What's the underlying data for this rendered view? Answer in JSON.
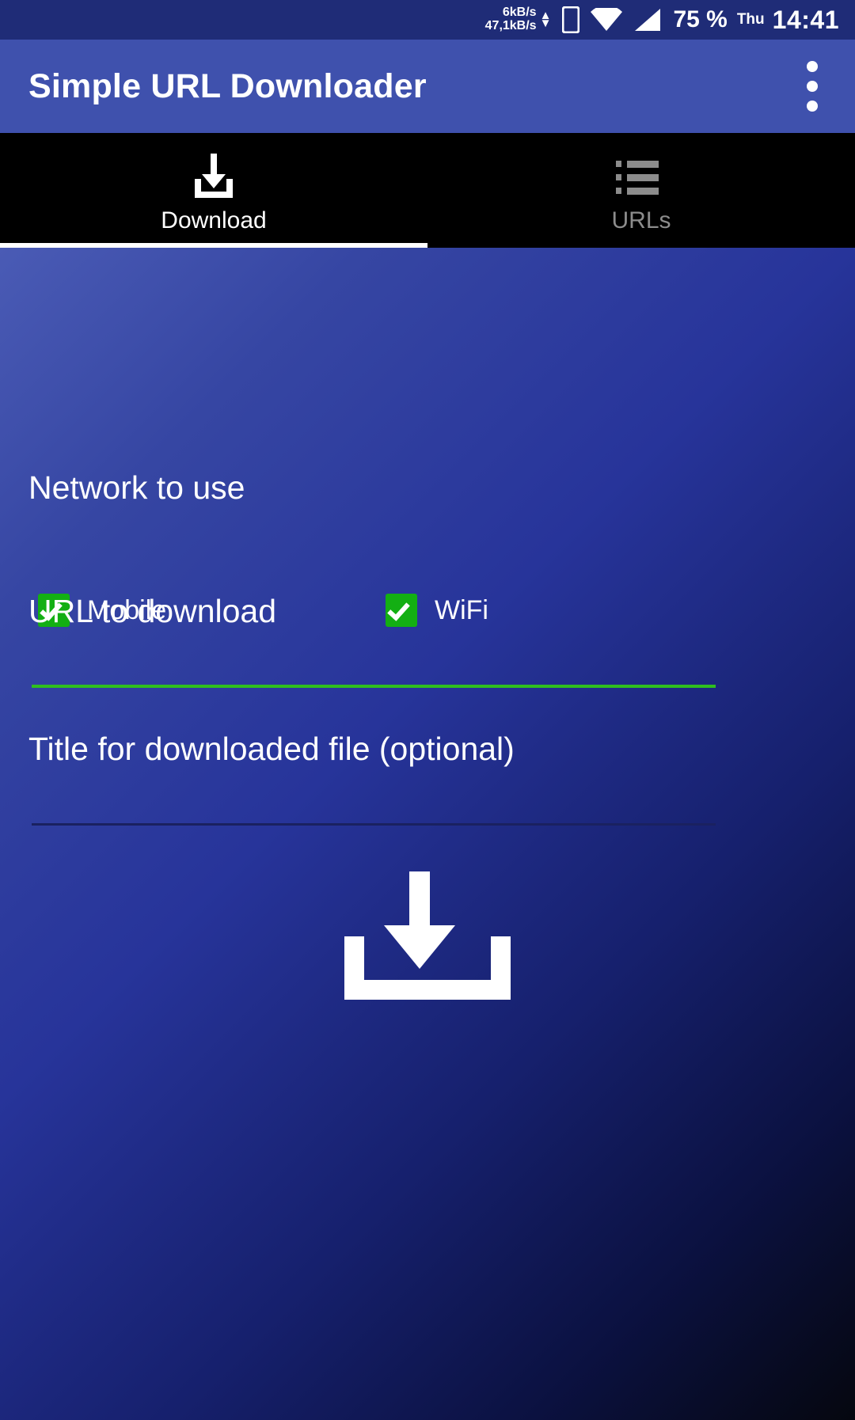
{
  "status_bar": {
    "net_speed_up": "6kB/s",
    "net_speed_down": "47,1kB/s",
    "up_arrow": "▲",
    "down_arrow": "▼",
    "sim_icon": "sim-card-icon",
    "wifi_icon": "wifi-icon",
    "signal_icon": "cellular-signal-icon",
    "battery": "75 %",
    "day": "Thu",
    "time": "14:41"
  },
  "app_bar": {
    "title": "Simple URL Downloader",
    "overflow_icon": "overflow-menu-icon"
  },
  "tabs": [
    {
      "label": "Download",
      "icon": "download-icon",
      "active": true
    },
    {
      "label": "URLs",
      "icon": "list-icon",
      "active": false
    }
  ],
  "main": {
    "network_heading": "Network to use",
    "checkboxes": [
      {
        "label": "Mobile",
        "checked": true
      },
      {
        "label": "WiFi",
        "checked": true
      }
    ],
    "url_field": {
      "label": "URL to download",
      "value": "",
      "placeholder": "",
      "focused": true
    },
    "title_field": {
      "label": "Title for downloaded file (optional)",
      "value": "",
      "placeholder": "",
      "focused": false
    },
    "download_button_icon": "download-icon"
  },
  "colors": {
    "status_bar_bg": "#1f2c77",
    "app_bar_bg": "#3f51ad",
    "tab_bar_bg": "#000000",
    "accent_green": "#13af13",
    "focused_underline": "#2fbf1f",
    "unfocused_underline": "#1a2160",
    "content_gradient_start": "#4a5bb5",
    "content_gradient_end": "#05070f",
    "text_primary": "#ffffff",
    "tab_inactive": "#8c8c8c"
  }
}
